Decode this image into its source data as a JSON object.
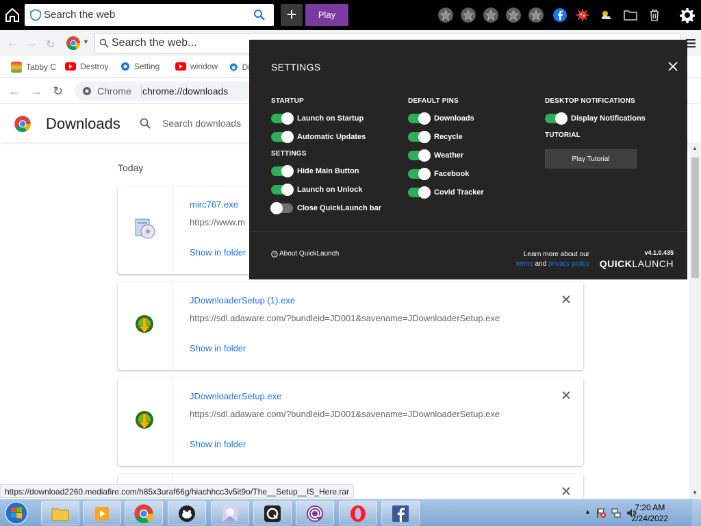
{
  "quicklaunch_bar": {
    "search_placeholder": "Search the web",
    "play_label": "Play"
  },
  "browser_old": {
    "omnibox_text": "Search the web..."
  },
  "bookmarks": [
    {
      "label": "Tabby C",
      "color": "#e53935"
    },
    {
      "label": "Destroy",
      "color": "#ff0000"
    },
    {
      "label": "Setting",
      "color": "#1a73e8"
    },
    {
      "label": "window",
      "color": "#ff0000"
    },
    {
      "label": "Di",
      "color": "#1e88e5"
    }
  ],
  "address_bar": {
    "site_label": "Chrome",
    "url": "chrome://downloads"
  },
  "downloads_page": {
    "title": "Downloads",
    "search_placeholder": "Search downloads",
    "section_today": "Today",
    "items": [
      {
        "filename": "mirc767.exe",
        "url": "https://www.m",
        "action": "Show in folder"
      },
      {
        "filename": "JDownloaderSetup (1).exe",
        "url": "https://sdl.adaware.com/?bundleid=JD001&savename=JDownloaderSetup.exe",
        "action": "Show in folder"
      },
      {
        "filename": "JDownloaderSetup.exe",
        "url": "https://sdl.adaware.com/?bundleid=JD001&savename=JDownloaderSetup.exe",
        "action": "Show in folder"
      }
    ]
  },
  "status_link": "https://download2260.mediafire.com/h85x3uraf66g/hiachhcc3v5it9o/The__Setup__IS_Here.rar",
  "settings_panel": {
    "title": "SETTINGS",
    "startup": {
      "heading": "STARTUP",
      "toggles": [
        {
          "label": "Launch on Startup",
          "on": true
        },
        {
          "label": "Automatic Updates",
          "on": true
        }
      ]
    },
    "settings": {
      "heading": "SETTINGS",
      "toggles": [
        {
          "label": "Hide Main Button",
          "on": true
        },
        {
          "label": "Launch on Unlock",
          "on": true
        },
        {
          "label": "Close QuickLaunch bar",
          "on": false
        }
      ]
    },
    "default_pins": {
      "heading": "DEFAULT PINS",
      "toggles": [
        {
          "label": "Downloads",
          "on": true
        },
        {
          "label": "Recycle",
          "on": true
        },
        {
          "label": "Weather",
          "on": true
        },
        {
          "label": "Facebook",
          "on": true
        },
        {
          "label": "Covid Tracker",
          "on": true
        }
      ]
    },
    "desktop_notifications": {
      "heading": "DESKTOP NOTIFICATIONS",
      "toggles": [
        {
          "label": "Display Notifications",
          "on": true
        }
      ]
    },
    "tutorial": {
      "heading": "TUTORIAL",
      "button_label": "Play Tutorial"
    },
    "about_label": "About QuickLaunch",
    "learn_more": "Learn more about our",
    "terms": "terms",
    "and": "and",
    "privacy_policy": "privacy policy",
    "version": "v4.1.0.435",
    "brand_bold": "QUICK",
    "brand_light": "LAUNCH"
  },
  "taskbar": {
    "time": "7:20 AM",
    "date": "2/24/2022"
  },
  "colors": {
    "accent_purple": "#7c3aa1",
    "toggle_on": "#2fae5a",
    "link_blue": "#1a73e8"
  }
}
